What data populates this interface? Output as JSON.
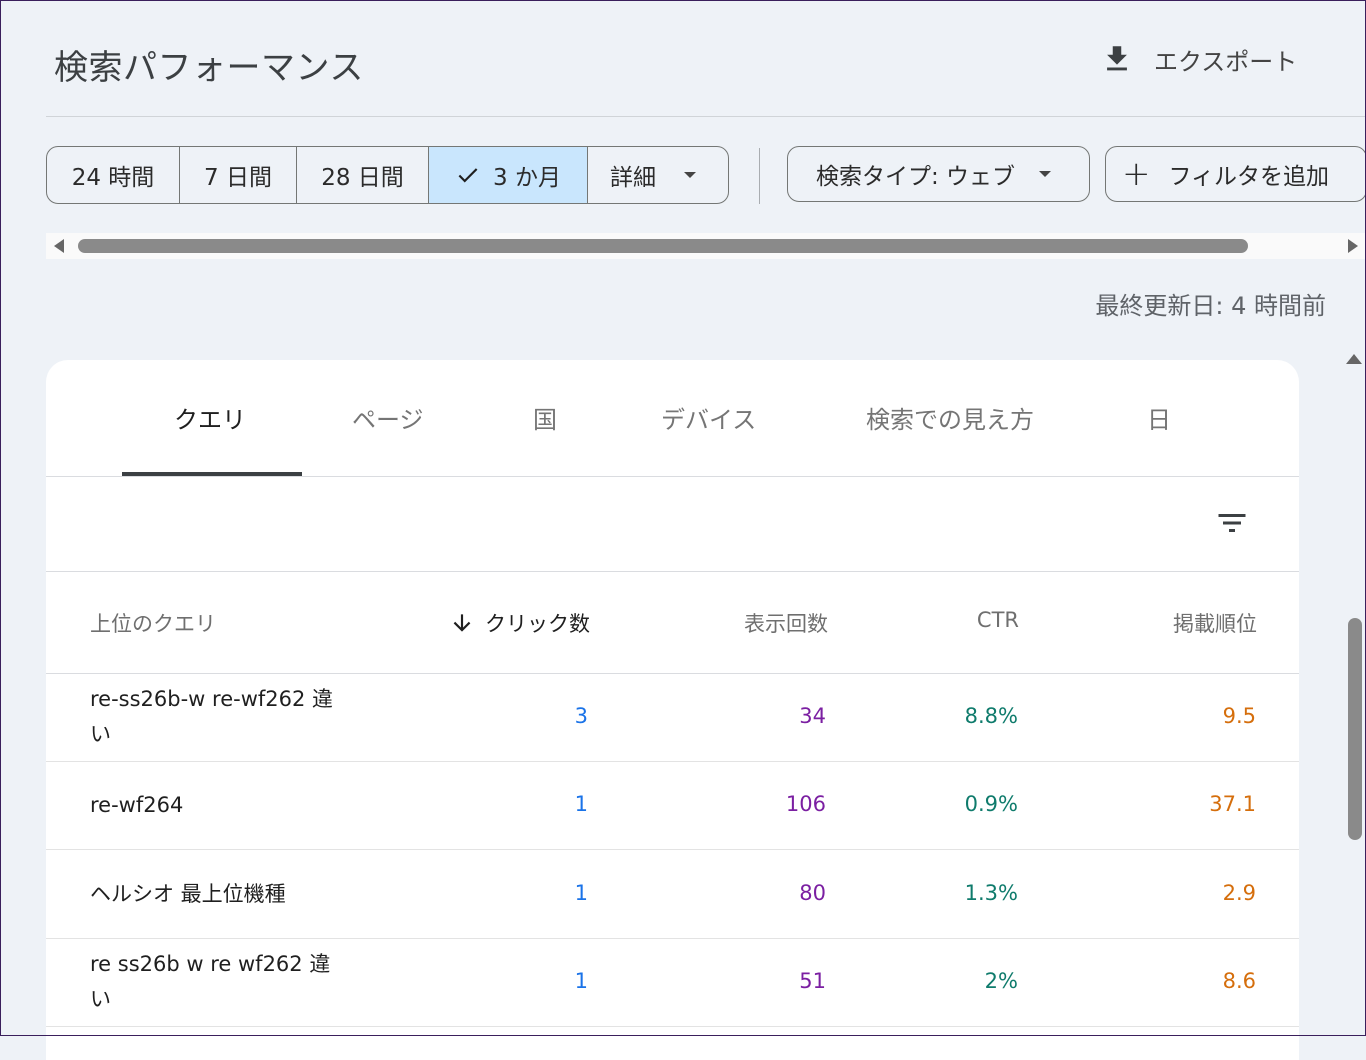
{
  "header": {
    "title": "検索パフォーマンス",
    "export_label": "エクスポート"
  },
  "date_range": {
    "options": [
      "24 時間",
      "7 日間",
      "28 日間",
      "3 か月",
      "詳細"
    ],
    "selected": "3 か月"
  },
  "filters": {
    "search_type": "検索タイプ: ウェブ",
    "add_filter": "フィルタを追加"
  },
  "last_updated": "最終更新日: 4 時間前",
  "tabs": [
    "クエリ",
    "ページ",
    "国",
    "デバイス",
    "検索での見え方",
    "日"
  ],
  "active_tab": "クエリ",
  "table": {
    "columns": [
      "上位のクエリ",
      "クリック数",
      "表示回数",
      "CTR",
      "掲載順位"
    ],
    "sorted_column": "クリック数",
    "rows": [
      {
        "query": "re-ss26b-w re-wf262 違い",
        "clicks": "3",
        "impressions": "34",
        "ctr": "8.8%",
        "position": "9.5"
      },
      {
        "query": "re-wf264",
        "clicks": "1",
        "impressions": "106",
        "ctr": "0.9%",
        "position": "37.1"
      },
      {
        "query": "ヘルシオ 最上位機種",
        "clicks": "1",
        "impressions": "80",
        "ctr": "1.3%",
        "position": "2.9"
      },
      {
        "query": "re ss26b w re wf262 違い",
        "clicks": "1",
        "impressions": "51",
        "ctr": "2%",
        "position": "8.6"
      }
    ]
  },
  "colors": {
    "clicks": "#1a73e8",
    "impressions": "#7b1fa2",
    "ctr": "#0f7b6c",
    "position": "#d56e0c",
    "selected_range_bg": "#c9e6fd"
  }
}
